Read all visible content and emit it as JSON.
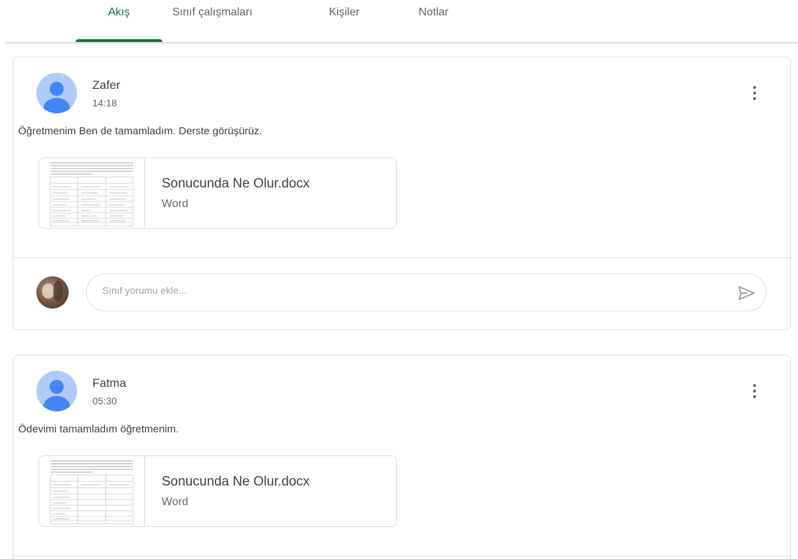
{
  "tabs": [
    {
      "label": "Akış",
      "active": true
    },
    {
      "label": "Sınıf çalışmaları",
      "active": false
    },
    {
      "label": "Kişiler",
      "active": false
    },
    {
      "label": "Notlar",
      "active": false
    }
  ],
  "posts": [
    {
      "author": "Zafer",
      "time": "14:18",
      "text": "Öğretmenim Ben de tamamladım. Derste görüşürüz.",
      "attachment": {
        "name": "Sonucunda Ne Olur.docx",
        "type": "Word"
      },
      "comment": {
        "placeholder": "Sınıf yorumu ekle..."
      }
    },
    {
      "author": "Fatma",
      "time": "05:30",
      "text": "Ödevimi tamamladım öğretmenim.",
      "attachment": {
        "name": "Sonucunda Ne Olur.docx",
        "type": "Word"
      }
    }
  ],
  "colors": {
    "accent": "#137333",
    "avatar_bg": "#aecbfa",
    "avatar_fg": "#4285f4"
  },
  "icons": {
    "more": "more-vert-icon",
    "send": "send-icon",
    "avatar": "account-avatar-icon"
  }
}
